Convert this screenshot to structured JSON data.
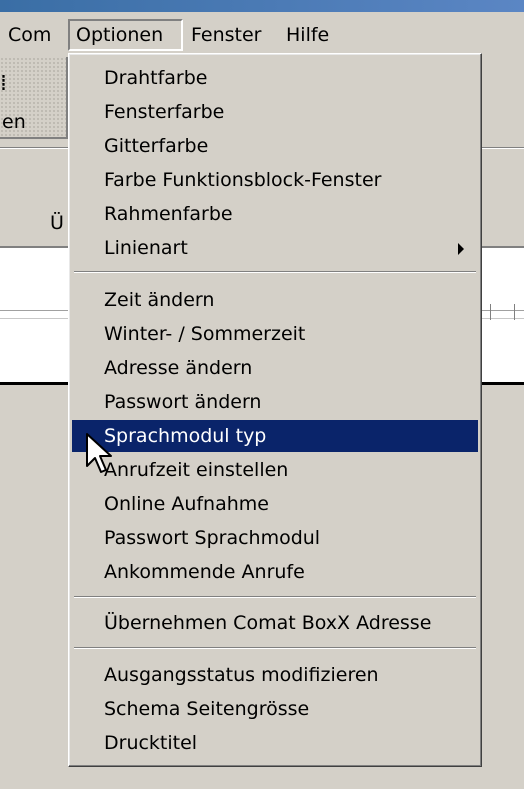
{
  "menubar": {
    "items": [
      {
        "label": "Com"
      },
      {
        "label": "Optionen"
      },
      {
        "label": "Fenster"
      },
      {
        "label": "Hilfe"
      }
    ]
  },
  "background": {
    "toolbar_button_label": "en",
    "partial_label": "Ü"
  },
  "menu": {
    "items": [
      {
        "label": "Drahtfarbe"
      },
      {
        "label": "Fensterfarbe"
      },
      {
        "label": "Gitterfarbe"
      },
      {
        "label": "Farbe Funktionsblock-Fenster"
      },
      {
        "label": "Rahmenfarbe"
      },
      {
        "label": "Linienart"
      },
      {
        "label": "Zeit ändern"
      },
      {
        "label": "Winter- / Sommerzeit"
      },
      {
        "label": "Adresse ändern"
      },
      {
        "label": "Passwort ändern"
      },
      {
        "label": "Sprachmodul typ"
      },
      {
        "label": "Anrufzeit einstellen"
      },
      {
        "label": "Online Aufnahme"
      },
      {
        "label": "Passwort Sprachmodul"
      },
      {
        "label": "Ankommende Anrufe"
      },
      {
        "label": "Übernehmen Comat BoxX Adresse"
      },
      {
        "label": "Ausgangsstatus modifizieren"
      },
      {
        "label": "Schema Seitengrösse"
      },
      {
        "label": "Drucktitel"
      }
    ],
    "highlighted_item": "Sprachmodul typ",
    "submenu_item": "Linienart"
  },
  "colors": {
    "highlight": "#0a246a",
    "face": "#d4d0c8"
  }
}
